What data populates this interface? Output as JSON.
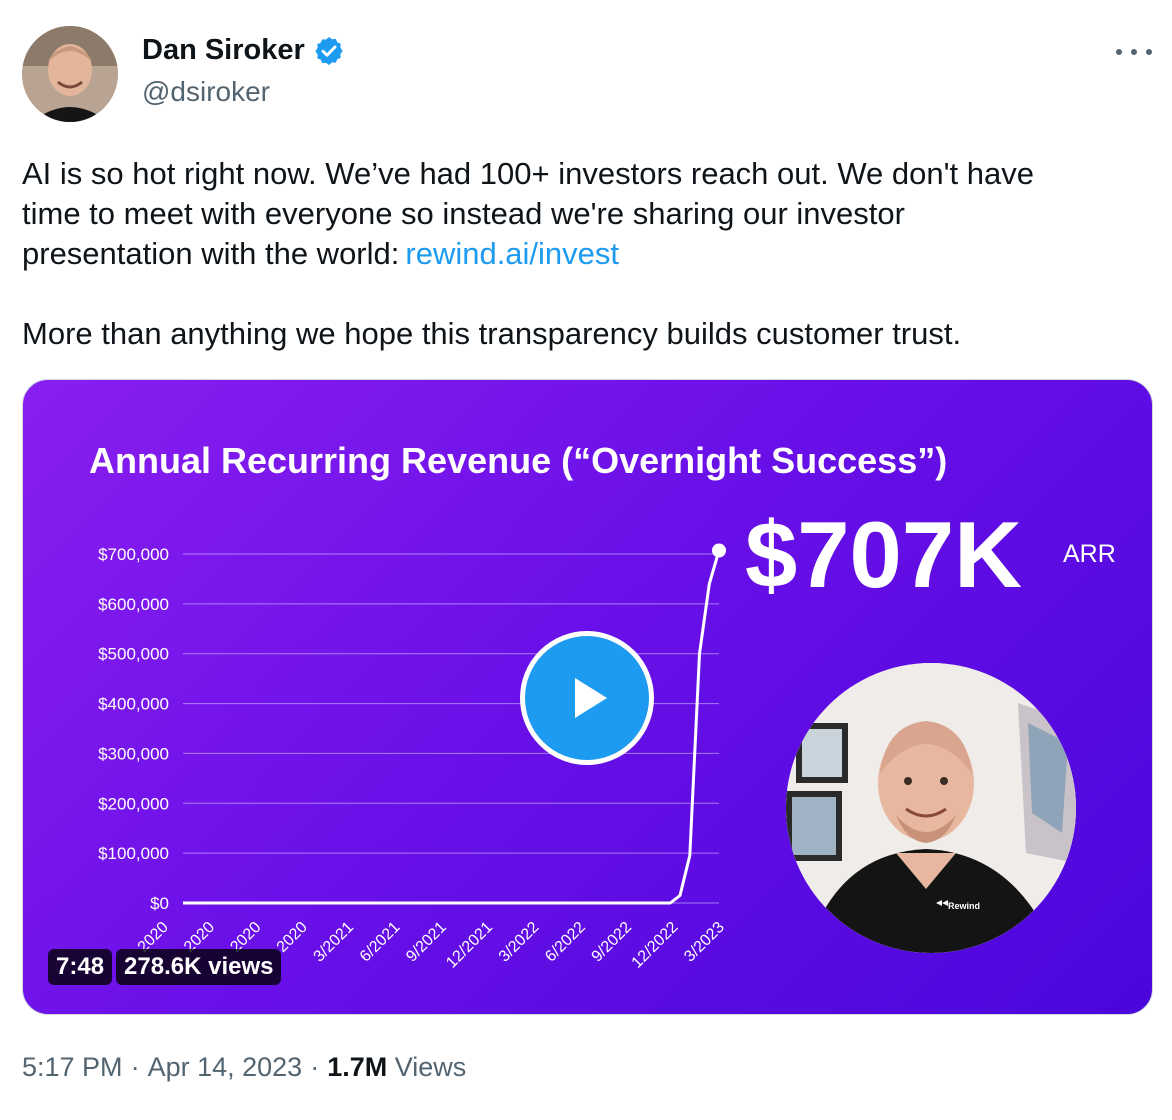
{
  "author": {
    "display_name": "Dan Siroker",
    "handle": "@dsiroker",
    "verified": true
  },
  "tweet": {
    "line1": "AI is so hot right now. We’ve had 100+ investors reach out. We don't have",
    "line2": "time to meet with everyone so instead we're sharing our investor",
    "line3_prefix": "presentation with the world:",
    "link_text": "rewind.ai/invest",
    "line4": "More than anything we hope this transparency builds customer trust."
  },
  "media": {
    "headline_value": "$707K",
    "headline_unit": "ARR",
    "presenter_shirt_text": "Rewind",
    "duration": "7:48",
    "views": "278.6K views"
  },
  "chart_data": {
    "type": "line",
    "title": "Annual Recurring Revenue (“Overnight Success”)",
    "xlabel": "",
    "ylabel": "",
    "ylim": [
      0,
      700000
    ],
    "y_ticks": [
      "$0",
      "$100,000",
      "$200,000",
      "$300,000",
      "$400,000",
      "$500,000",
      "$600,000",
      "$700,000"
    ],
    "x_ticks": [
      "2020",
      "2020",
      "2020",
      "2020",
      "3/2021",
      "6/2021",
      "9/2021",
      "12/2021",
      "3/2022",
      "6/2022",
      "9/2022",
      "12/2022",
      "3/2023"
    ],
    "series": [
      {
        "values": [
          0,
          0,
          0,
          0,
          0,
          0,
          0,
          0,
          0,
          0,
          0,
          0,
          0,
          0,
          0,
          0,
          0,
          0,
          0,
          0,
          0,
          0,
          0,
          0,
          0,
          0,
          0,
          0,
          0,
          0,
          0,
          0,
          0,
          0,
          0,
          0,
          0,
          0,
          0,
          0,
          0,
          0,
          0,
          0,
          0,
          0,
          0,
          0,
          0,
          0,
          0,
          15000,
          95000,
          500000,
          640000,
          707000
        ]
      }
    ],
    "grid": true,
    "line_color": "#ffffff",
    "background_gradient": [
      "#8a1ef0",
      "#4a06db"
    ]
  },
  "footer": {
    "time": "5:17 PM",
    "date": "Apr 14, 2023",
    "view_count": "1.7M",
    "view_label": "Views",
    "separator": "·"
  },
  "colors": {
    "link": "#1d9bf0",
    "secondary_text": "#536471",
    "verified_badge": "#1d9bf0"
  }
}
